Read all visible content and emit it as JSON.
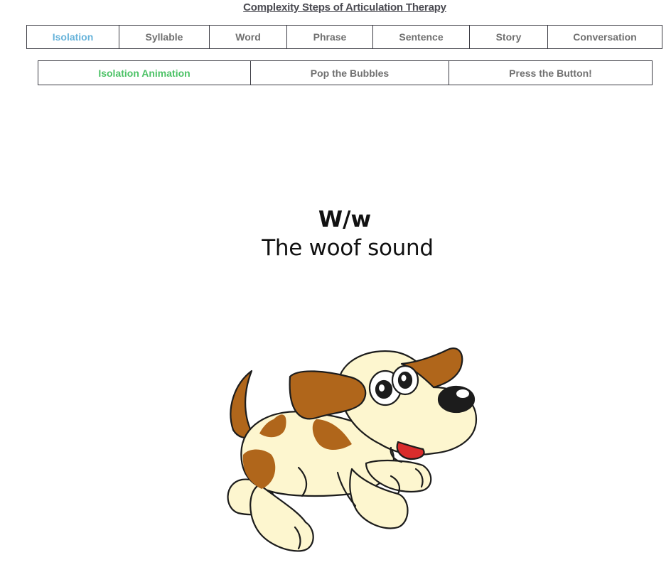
{
  "page": {
    "title": "Complexity Steps of Articulation Therapy"
  },
  "tabs": [
    {
      "label": "Isolation",
      "active": true
    },
    {
      "label": "Syllable",
      "active": false
    },
    {
      "label": "Word",
      "active": false
    },
    {
      "label": "Phrase",
      "active": false
    },
    {
      "label": "Sentence",
      "active": false
    },
    {
      "label": "Story",
      "active": false
    },
    {
      "label": "Conversation",
      "active": false
    }
  ],
  "subtabs": [
    {
      "label": "Isolation Animation",
      "active": true
    },
    {
      "label": "Pop the Bubbles",
      "active": false
    },
    {
      "label": "Press the Button!",
      "active": false
    }
  ],
  "sound": {
    "letter": "W/w",
    "description": "The woof sound"
  },
  "illustration": {
    "subject": "cartoon-dog",
    "colors": {
      "body": "#fdf6cf",
      "spots": "#b0661b",
      "outline": "#1c1c1c",
      "tongue": "#d92c2c"
    }
  },
  "colors": {
    "active_tab": "#67b3da",
    "active_subtab": "#4cc266",
    "inactive_text": "#707070",
    "border": "#3c3c44"
  }
}
